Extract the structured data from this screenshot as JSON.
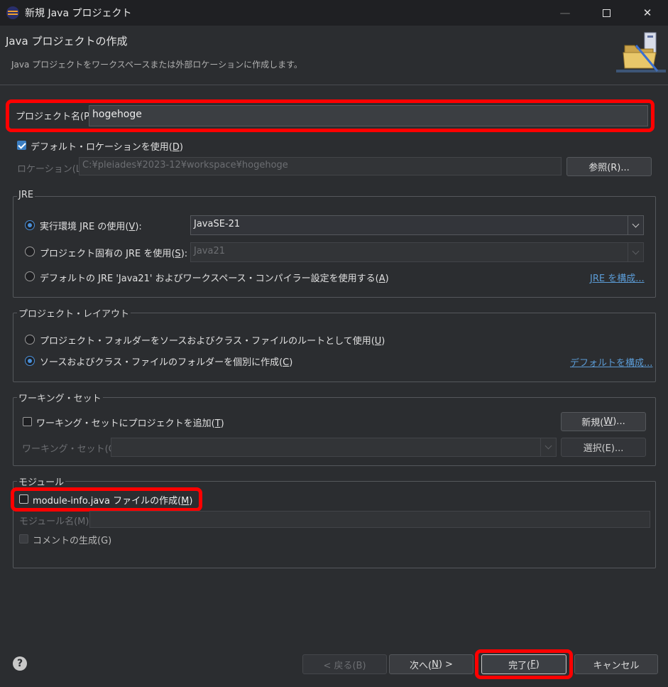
{
  "window": {
    "title": "新規 Java プロジェクト",
    "minimize_glyph": "—",
    "close_glyph": "✕"
  },
  "header": {
    "title": "Java プロジェクトの作成",
    "description": "Java プロジェクトをワークスペースまたは外部ロケーションに作成します。"
  },
  "project_name": {
    "label": "プロジェクト名(P):",
    "value": "hogehoge"
  },
  "location": {
    "use_default_label_pre": "デフォルト・ロケーションを使用(",
    "use_default_mnemonic": "D",
    "use_default_label_post": ")",
    "use_default_checked": true,
    "label": "ロケーション(L):",
    "path": "C:¥pleiades¥2023-12¥workspace¥hogehoge",
    "browse_button": "参照(R)..."
  },
  "jre": {
    "group_title": "JRE",
    "option1_pre": "実行環境 JRE の使用(",
    "option1_mn": "V",
    "option1_post": "):",
    "option1_value": "JavaSE-21",
    "option2_pre": "プロジェクト固有の JRE を使用(",
    "option2_mn": "S",
    "option2_post": "):",
    "option2_value": "Java21",
    "option3_pre": "デフォルトの JRE 'Java21' およびワークスペース・コンパイラー設定を使用する(",
    "option3_mn": "A",
    "option3_post": ")",
    "configure_link": "JRE を構成..."
  },
  "layout": {
    "group_title": "プロジェクト・レイアウト",
    "option1_pre": "プロジェクト・フォルダーをソースおよびクラス・ファイルのルートとして使用(",
    "option1_mn": "U",
    "option1_post": ")",
    "option2_pre": "ソースおよびクラス・ファイルのフォルダーを個別に作成(",
    "option2_mn": "C",
    "option2_post": ")",
    "configure_link": "デフォルトを構成..."
  },
  "working_set": {
    "group_title": "ワーキング・セット",
    "add_label_pre": "ワーキング・セットにプロジェクトを追加(",
    "add_mn": "T",
    "add_label_post": ")",
    "new_button_pre": "新規(",
    "new_button_mn": "W",
    "new_button_post": ")...",
    "field_label": "ワーキング・セット(O):",
    "select_button": "選択(E)..."
  },
  "module": {
    "group_title": "モジュール",
    "create_label_pre": "module-info.java ファイルの作成(",
    "create_mn": "M",
    "create_label_post": ")",
    "name_label": "モジュール名(M):",
    "comment_label": "コメントの生成(G)"
  },
  "footer": {
    "help_icon": "?",
    "back_button": "< 戻る(B)",
    "next_button_pre": "次へ(",
    "next_button_mn": "N",
    "next_button_post": ") >",
    "finish_button_pre": "完了(",
    "finish_button_mn": "F",
    "finish_button_post": ")",
    "cancel_button": "キャンセル"
  },
  "colors": {
    "background": "#2b2d30",
    "highlight": "#ff0000",
    "accent": "#4a90d9",
    "link": "#5b9bd5"
  }
}
